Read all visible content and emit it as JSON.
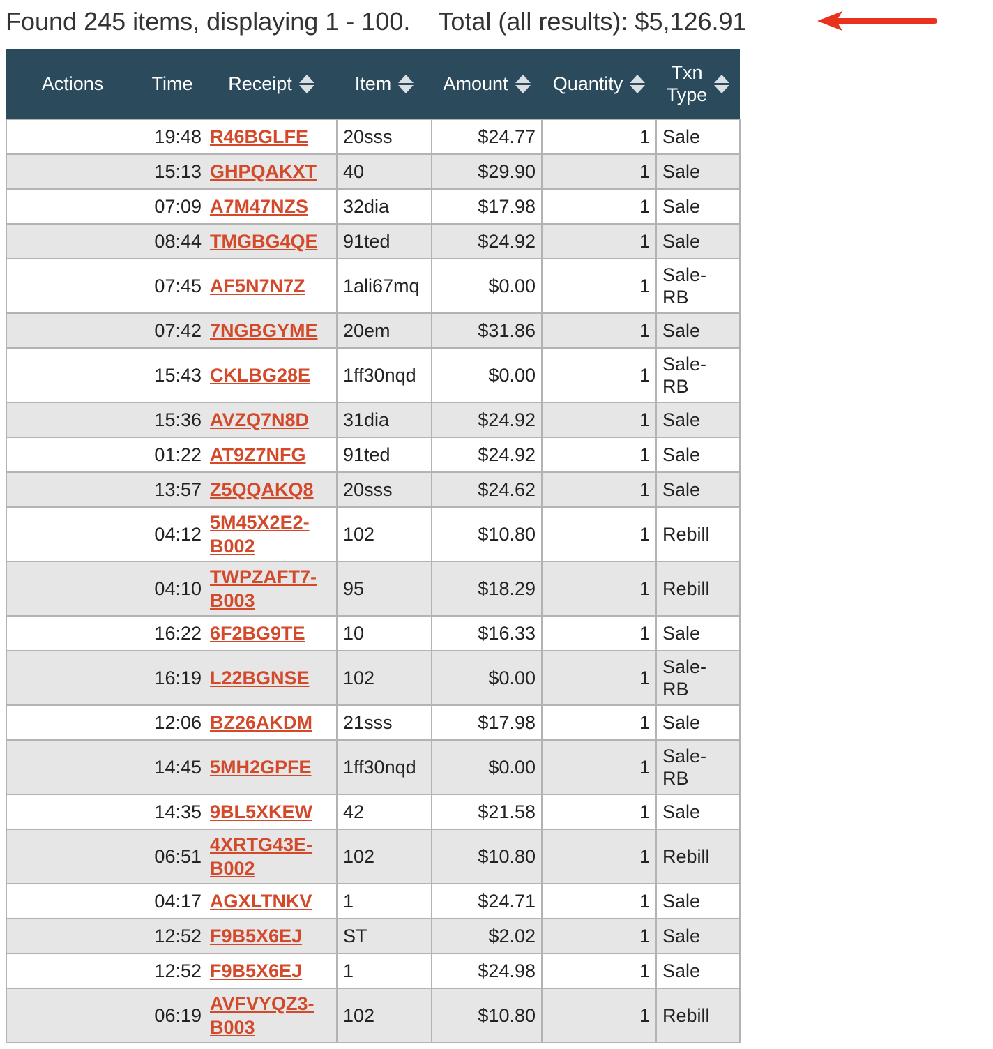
{
  "summary": {
    "found_text": "Found 245 items, displaying 1 - 100.",
    "total_text": "Total (all results): $5,126.91"
  },
  "colors": {
    "header_bg": "#2b4a5c",
    "link": "#d3492a",
    "alt_row": "#e6e6e6",
    "arrow": "#e8321e"
  },
  "icons": {
    "sort": "sort-updown-icon",
    "arrow": "red-arrow-left-icon"
  },
  "table": {
    "headers": {
      "actions": "Actions",
      "time": "Time",
      "receipt": "Receipt",
      "item": "Item",
      "amount": "Amount",
      "quantity": "Quantity",
      "txn_type_line1": "Txn",
      "txn_type_line2": "Type"
    },
    "rows": [
      {
        "time": "19:48",
        "receipt": "R46BGLFE",
        "item": "20sss",
        "amount": "$24.77",
        "qty": "1",
        "type": "Sale"
      },
      {
        "time": "15:13",
        "receipt": "GHPQAKXT",
        "item": "40",
        "amount": "$29.90",
        "qty": "1",
        "type": "Sale"
      },
      {
        "time": "07:09",
        "receipt": "A7M47NZS",
        "item": "32dia",
        "amount": "$17.98",
        "qty": "1",
        "type": "Sale"
      },
      {
        "time": "08:44",
        "receipt": "TMGBG4QE",
        "item": "91ted",
        "amount": "$24.92",
        "qty": "1",
        "type": "Sale"
      },
      {
        "time": "07:45",
        "receipt": "AF5N7N7Z",
        "item": "1ali67mq",
        "amount": "$0.00",
        "qty": "1",
        "type": "Sale-RB"
      },
      {
        "time": "07:42",
        "receipt": "7NGBGYME",
        "item": "20em",
        "amount": "$31.86",
        "qty": "1",
        "type": "Sale"
      },
      {
        "time": "15:43",
        "receipt": "CKLBG28E",
        "item": "1ff30nqd",
        "amount": "$0.00",
        "qty": "1",
        "type": "Sale-RB"
      },
      {
        "time": "15:36",
        "receipt": "AVZQ7N8D",
        "item": "31dia",
        "amount": "$24.92",
        "qty": "1",
        "type": "Sale"
      },
      {
        "time": "01:22",
        "receipt": "AT9Z7NFG",
        "item": "91ted",
        "amount": "$24.92",
        "qty": "1",
        "type": "Sale"
      },
      {
        "time": "13:57",
        "receipt": "Z5QQAKQ8",
        "item": "20sss",
        "amount": "$24.62",
        "qty": "1",
        "type": "Sale"
      },
      {
        "time": "04:12",
        "receipt": "5M45X2E2-B002",
        "item": "102",
        "amount": "$10.80",
        "qty": "1",
        "type": "Rebill"
      },
      {
        "time": "04:10",
        "receipt": "TWPZAFT7-B003",
        "item": "95",
        "amount": "$18.29",
        "qty": "1",
        "type": "Rebill"
      },
      {
        "time": "16:22",
        "receipt": "6F2BG9TE",
        "item": "10",
        "amount": "$16.33",
        "qty": "1",
        "type": "Sale"
      },
      {
        "time": "16:19",
        "receipt": "L22BGNSE",
        "item": "102",
        "amount": "$0.00",
        "qty": "1",
        "type": "Sale-RB"
      },
      {
        "time": "12:06",
        "receipt": "BZ26AKDM",
        "item": "21sss",
        "amount": "$17.98",
        "qty": "1",
        "type": "Sale"
      },
      {
        "time": "14:45",
        "receipt": "5MH2GPFE",
        "item": "1ff30nqd",
        "amount": "$0.00",
        "qty": "1",
        "type": "Sale-RB"
      },
      {
        "time": "14:35",
        "receipt": "9BL5XKEW",
        "item": "42",
        "amount": "$21.58",
        "qty": "1",
        "type": "Sale"
      },
      {
        "time": "06:51",
        "receipt": "4XRTG43E-B002",
        "item": "102",
        "amount": "$10.80",
        "qty": "1",
        "type": "Rebill"
      },
      {
        "time": "04:17",
        "receipt": "AGXLTNKV",
        "item": "1",
        "amount": "$24.71",
        "qty": "1",
        "type": "Sale"
      },
      {
        "time": "12:52",
        "receipt": "F9B5X6EJ",
        "item": "ST",
        "amount": "$2.02",
        "qty": "1",
        "type": "Sale"
      },
      {
        "time": "12:52",
        "receipt": "F9B5X6EJ",
        "item": "1",
        "amount": "$24.98",
        "qty": "1",
        "type": "Sale"
      },
      {
        "time": "06:19",
        "receipt": "AVFVYQZ3-B003",
        "item": "102",
        "amount": "$10.80",
        "qty": "1",
        "type": "Rebill"
      }
    ]
  }
}
